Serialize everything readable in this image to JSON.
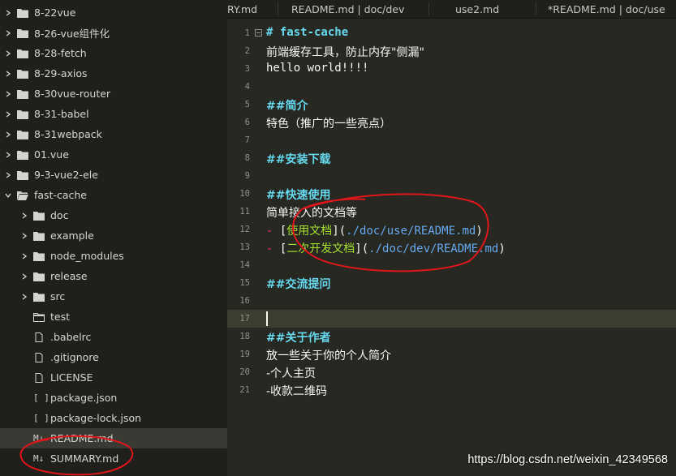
{
  "sidebar": {
    "items": [
      {
        "label": "8-22vue",
        "type": "folder",
        "depth": 0,
        "expanded": false
      },
      {
        "label": "8-26-vue组件化",
        "type": "folder",
        "depth": 0,
        "expanded": false
      },
      {
        "label": "8-28-fetch",
        "type": "folder",
        "depth": 0,
        "expanded": false
      },
      {
        "label": "8-29-axios",
        "type": "folder",
        "depth": 0,
        "expanded": false
      },
      {
        "label": "8-30vue-router",
        "type": "folder",
        "depth": 0,
        "expanded": false
      },
      {
        "label": "8-31-babel",
        "type": "folder",
        "depth": 0,
        "expanded": false
      },
      {
        "label": "8-31webpack",
        "type": "folder",
        "depth": 0,
        "expanded": false
      },
      {
        "label": "01.vue",
        "type": "folder",
        "depth": 0,
        "expanded": false
      },
      {
        "label": "9-3-vue2-ele",
        "type": "folder",
        "depth": 0,
        "expanded": false
      },
      {
        "label": "fast-cache",
        "type": "folder-open",
        "depth": 0,
        "expanded": true
      },
      {
        "label": "doc",
        "type": "folder",
        "depth": 1,
        "expanded": false
      },
      {
        "label": "example",
        "type": "folder",
        "depth": 1,
        "expanded": false
      },
      {
        "label": "node_modules",
        "type": "folder",
        "depth": 1,
        "expanded": false
      },
      {
        "label": "release",
        "type": "folder",
        "depth": 1,
        "expanded": false
      },
      {
        "label": "src",
        "type": "folder",
        "depth": 1,
        "expanded": false
      },
      {
        "label": "test",
        "type": "folder-empty",
        "depth": 1,
        "expanded": null
      },
      {
        "label": ".babelrc",
        "type": "file",
        "depth": 1,
        "expanded": null
      },
      {
        "label": ".gitignore",
        "type": "file",
        "depth": 1,
        "expanded": null
      },
      {
        "label": "LICENSE",
        "type": "file",
        "depth": 1,
        "expanded": null
      },
      {
        "label": "package.json",
        "type": "json",
        "depth": 1,
        "expanded": null,
        "glyph": "[ ]"
      },
      {
        "label": "package-lock.json",
        "type": "json",
        "depth": 1,
        "expanded": null,
        "glyph": "[ ]"
      },
      {
        "label": "README.md",
        "type": "markdown",
        "depth": 1,
        "expanded": null,
        "glyph": "M↓",
        "selected": true
      },
      {
        "label": "SUMMARY.md",
        "type": "markdown",
        "depth": 1,
        "expanded": null,
        "glyph": "M↓"
      }
    ]
  },
  "tabs": [
    {
      "label": "RY.md"
    },
    {
      "label": "README.md | doc/dev"
    },
    {
      "label": "use2.md"
    },
    {
      "label": "*README.md | doc/use"
    }
  ],
  "editor": {
    "lines": [
      {
        "n": "1"
      },
      {
        "n": "2"
      },
      {
        "n": "3"
      },
      {
        "n": "4"
      },
      {
        "n": "5"
      },
      {
        "n": "6"
      },
      {
        "n": "7"
      },
      {
        "n": "8"
      },
      {
        "n": "9"
      },
      {
        "n": "10"
      },
      {
        "n": "11"
      },
      {
        "n": "12"
      },
      {
        "n": "13"
      },
      {
        "n": "14"
      },
      {
        "n": "15"
      },
      {
        "n": "16"
      },
      {
        "n": "17"
      },
      {
        "n": "18"
      },
      {
        "n": "19"
      },
      {
        "n": "20"
      },
      {
        "n": "21"
      }
    ],
    "l1": "# fast-cache",
    "l2": "前端缓存工具，防止内存\"侧漏\"",
    "l3": "hello world!!!!",
    "l5": "##简介",
    "l6": "特色（推广的一些亮点）",
    "l8": "##安装下载",
    "l10": "##快速使用",
    "l11": "简单接入的文档等",
    "l12": {
      "dash": "- ",
      "lb": "[",
      "text": "使用文档",
      "mid": "](",
      "url": "./doc/use/README.md",
      "rb": ")"
    },
    "l13": {
      "dash": "- ",
      "lb": "[",
      "text": "二次开发文档",
      "mid": "](",
      "url": "./doc/dev/README.md",
      "rb": ")"
    },
    "l15": "##交流提问",
    "l18": "##关于作者",
    "l19": "放一些关于你的个人简介",
    "l20": "-个人主页",
    "l21": "-收款二维码",
    "current_line": 17
  },
  "watermark": "https://blog.csdn.net/weixin_42349568",
  "colors": {
    "sidebar_bg": "#1f1f1c",
    "editor_bg": "#272822",
    "heading": "#66d9ef",
    "link_text": "#a6e22e",
    "link_url": "#66a9ef",
    "annotation": "#e0161b"
  }
}
